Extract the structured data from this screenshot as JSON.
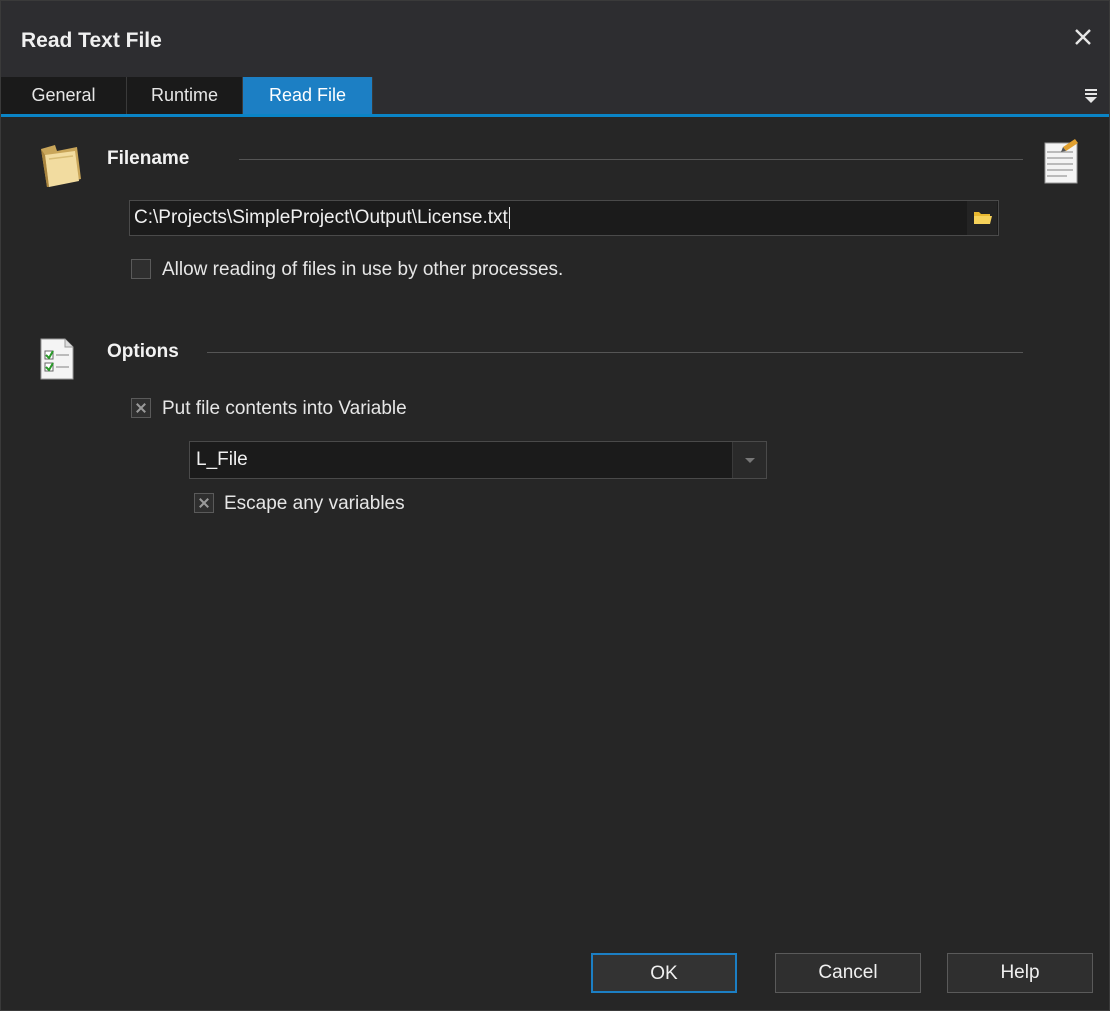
{
  "window": {
    "title": "Read Text File"
  },
  "tabs": [
    {
      "label": "General",
      "active": false
    },
    {
      "label": "Runtime",
      "active": false
    },
    {
      "label": "Read File",
      "active": true
    }
  ],
  "filename_section": {
    "title": "Filename",
    "path_value": "C:\\Projects\\SimpleProject\\Output\\License.txt",
    "allow_in_use_label": "Allow reading of files in use by other processes.",
    "allow_in_use_checked": false
  },
  "options_section": {
    "title": "Options",
    "put_into_variable_label": "Put file contents into Variable",
    "put_into_variable_checked": true,
    "variable_selected": "L_File",
    "escape_label": "Escape any variables",
    "escape_checked": true
  },
  "buttons": {
    "ok": "OK",
    "cancel": "Cancel",
    "help": "Help"
  },
  "colors": {
    "accent": "#1c7fc4",
    "background": "#262626"
  },
  "icons": {
    "close": "close-icon",
    "tab_menu": "menu-icon",
    "filename": "folder-icon",
    "options": "checklist-icon",
    "notes": "notepad-icon",
    "browse": "folder-open-icon"
  }
}
